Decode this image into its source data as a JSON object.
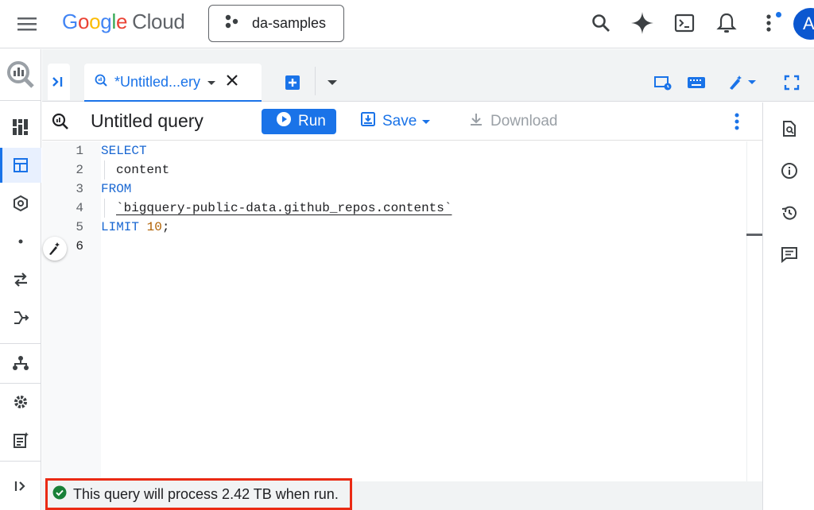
{
  "header": {
    "logo_google": [
      "G",
      "o",
      "o",
      "g",
      "l",
      "e"
    ],
    "logo_cloud": "Cloud",
    "project": "da-samples",
    "avatar_initial": "A"
  },
  "tabs": {
    "active_tab_label": "*Untitled...ery"
  },
  "query": {
    "title": "Untitled query",
    "run_label": "Run",
    "save_label": "Save",
    "download_label": "Download"
  },
  "editor": {
    "line_numbers": [
      "1",
      "2",
      "3",
      "4",
      "5",
      "6"
    ],
    "current_line": "6",
    "lines": {
      "l1_kw": "SELECT",
      "l2_text": "content",
      "l3_kw": "FROM",
      "l4_table": "`bigquery-public-data.github_repos.contents`",
      "l5_kw": "LIMIT",
      "l5_num": "10",
      "l5_end": ";"
    }
  },
  "status": {
    "message": "This query will process 2.42 TB when run.",
    "state": "valid"
  },
  "colors": {
    "accent": "#1a73e8",
    "keyword": "#1967d2",
    "number": "#b06000",
    "success": "#188038",
    "highlight_box": "#ea2a14"
  },
  "icons": {
    "top": [
      "menu-icon",
      "search-icon",
      "gemini-spark-icon",
      "cloud-shell-icon",
      "notifications-icon",
      "more-vert-icon"
    ],
    "left_nav": [
      "bigquery-logo-icon",
      "dashboard-icon",
      "studio-icon",
      "analytics-hub-icon",
      "dot-icon",
      "data-transfer-icon",
      "pipelines-icon",
      "lineage-icon",
      "settings-icon",
      "release-notes-icon",
      "expand-nav-icon"
    ],
    "right_panel": [
      "query-details-icon",
      "info-icon",
      "history-icon",
      "comments-icon"
    ]
  }
}
